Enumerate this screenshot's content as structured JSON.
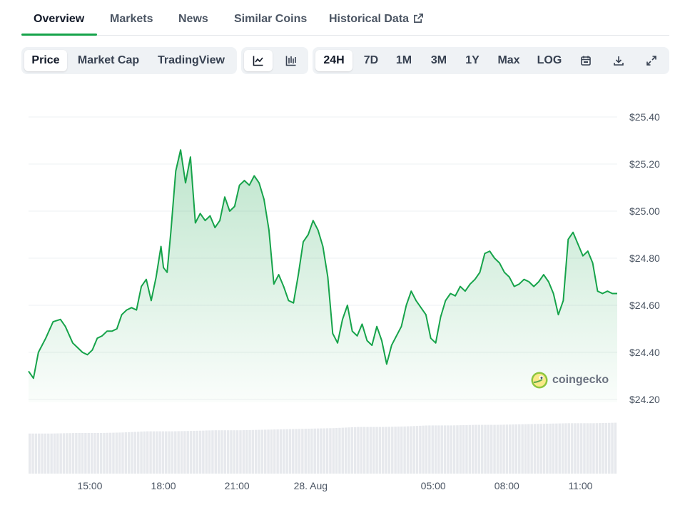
{
  "tabs": [
    {
      "label": "Overview",
      "active": true
    },
    {
      "label": "Markets",
      "active": false
    },
    {
      "label": "News",
      "active": false
    },
    {
      "label": "Similar Coins",
      "active": false
    },
    {
      "label": "Historical Data",
      "active": false,
      "icon": "external-link-icon"
    }
  ],
  "metric_toggle": [
    {
      "label": "Price",
      "active": true
    },
    {
      "label": "Market Cap",
      "active": false
    },
    {
      "label": "TradingView",
      "active": false
    }
  ],
  "chart_style": [
    {
      "icon": "line-chart-icon",
      "active": true
    },
    {
      "icon": "candlestick-chart-icon",
      "active": false
    }
  ],
  "ranges": [
    {
      "label": "24H",
      "active": true
    },
    {
      "label": "7D",
      "active": false
    },
    {
      "label": "1M",
      "active": false
    },
    {
      "label": "3M",
      "active": false
    },
    {
      "label": "1Y",
      "active": false
    },
    {
      "label": "Max",
      "active": false
    },
    {
      "label": "LOG",
      "active": false
    }
  ],
  "tools": [
    {
      "icon": "calendar-icon"
    },
    {
      "icon": "download-icon"
    },
    {
      "icon": "fullscreen-icon"
    }
  ],
  "watermark": {
    "text": "coingecko",
    "icon": "coingecko-logo-icon"
  },
  "colors": {
    "accent": "#16a34a",
    "line": "#16a34a",
    "fill": "#16a34a"
  },
  "chart_data": {
    "type": "area",
    "title": "",
    "ylabel": "",
    "xlabel": "",
    "y_ticks": [
      "$24.20",
      "$24.40",
      "$24.60",
      "$24.80",
      "$25.00",
      "$25.20",
      "$25.40"
    ],
    "y_tick_values": [
      24.2,
      24.4,
      24.6,
      24.8,
      25.0,
      25.2,
      25.4
    ],
    "ylim": [
      24.2,
      25.4
    ],
    "x_ticks": [
      {
        "label": "15:00",
        "t": 2.5
      },
      {
        "label": "18:00",
        "t": 5.5
      },
      {
        "label": "21:00",
        "t": 8.5
      },
      {
        "label": "28. Aug",
        "t": 11.5
      },
      {
        "label": "05:00",
        "t": 16.5
      },
      {
        "label": "08:00",
        "t": 19.5
      },
      {
        "label": "11:00",
        "t": 22.5
      }
    ],
    "x_range": [
      0,
      24
    ],
    "grid": true,
    "series": [
      {
        "t": [
          0,
          0.2,
          0.4,
          0.7,
          1.0,
          1.3,
          1.5,
          1.8,
          2.0,
          2.2,
          2.4,
          2.6,
          2.8,
          3.0,
          3.2,
          3.4,
          3.6,
          3.8,
          4.0,
          4.2,
          4.4,
          4.6,
          4.8,
          5.0,
          5.2,
          5.4,
          5.5,
          5.65,
          5.8,
          6.0,
          6.2,
          6.4,
          6.6,
          6.8,
          7.0,
          7.2,
          7.4,
          7.6,
          7.8,
          8.0,
          8.2,
          8.4,
          8.6,
          8.8,
          9.0,
          9.2,
          9.4,
          9.6,
          9.8,
          10.0,
          10.2,
          10.4,
          10.6,
          10.8,
          11.0,
          11.2,
          11.4,
          11.6,
          11.8,
          12.0,
          12.2,
          12.4,
          12.6,
          12.8,
          13.0,
          13.2,
          13.4,
          13.6,
          13.8,
          14.0,
          14.2,
          14.4,
          14.6,
          14.8,
          15.0,
          15.2,
          15.4,
          15.6,
          15.8,
          16.0,
          16.2,
          16.4,
          16.6,
          16.8,
          17.0,
          17.2,
          17.4,
          17.6,
          17.8,
          18.0,
          18.2,
          18.4,
          18.6,
          18.8,
          19.0,
          19.2,
          19.4,
          19.6,
          19.8,
          20.0,
          20.2,
          20.4,
          20.6,
          20.8,
          21.0,
          21.2,
          21.4,
          21.6,
          21.8,
          22.0,
          22.2,
          22.4,
          22.6,
          22.8,
          23.0,
          23.2,
          23.4,
          23.6,
          23.8,
          24.0
        ],
        "values": [
          24.32,
          24.29,
          24.4,
          24.46,
          24.53,
          24.54,
          24.51,
          24.44,
          24.42,
          24.4,
          24.39,
          24.41,
          24.46,
          24.47,
          24.49,
          24.49,
          24.5,
          24.56,
          24.58,
          24.59,
          24.58,
          24.68,
          24.71,
          24.62,
          24.72,
          24.85,
          24.76,
          24.74,
          24.91,
          25.17,
          25.26,
          25.12,
          25.23,
          24.95,
          24.99,
          24.96,
          24.98,
          24.93,
          24.96,
          25.06,
          25.0,
          25.02,
          25.11,
          25.13,
          25.11,
          25.15,
          25.12,
          25.05,
          24.92,
          24.69,
          24.73,
          24.68,
          24.62,
          24.61,
          24.73,
          24.87,
          24.9,
          24.96,
          24.92,
          24.85,
          24.72,
          24.48,
          24.44,
          24.54,
          24.6,
          24.49,
          24.47,
          24.52,
          24.45,
          24.43,
          24.51,
          24.45,
          24.35,
          24.43,
          24.47,
          24.51,
          24.6,
          24.66,
          24.62,
          24.59,
          24.56,
          24.46,
          24.44,
          24.55,
          24.62,
          24.65,
          24.64,
          24.68,
          24.66,
          24.69,
          24.71,
          24.74,
          24.82,
          24.83,
          24.8,
          24.78,
          24.74,
          24.72,
          24.68,
          24.69,
          24.71,
          24.7,
          24.68,
          24.7,
          24.73,
          24.7,
          24.65,
          24.56,
          24.62,
          24.88,
          24.91,
          24.86,
          24.81,
          24.83,
          24.78,
          24.66,
          24.65,
          24.66,
          24.65,
          24.65
        ],
        "volume_levels": [
          0.74,
          0.74,
          0.75,
          0.75,
          0.76,
          0.78,
          0.78,
          0.79,
          0.8,
          0.8,
          0.81,
          0.82,
          0.83,
          0.84,
          0.86,
          0.86,
          0.87,
          0.89,
          0.89,
          0.9,
          0.9,
          0.91,
          0.92,
          0.93,
          0.93,
          0.94
        ]
      }
    ]
  }
}
